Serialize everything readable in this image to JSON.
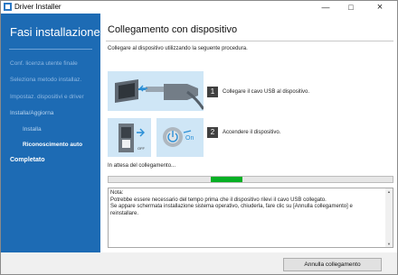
{
  "window": {
    "title": "Driver Installer"
  },
  "sidebar": {
    "title": "Fasi installazione",
    "steps": [
      {
        "label": "Conf. licenza utente finale"
      },
      {
        "label": "Seleziona metodo installaz."
      },
      {
        "label": "Impostaz. dispositivi e driver"
      },
      {
        "label": "Installa/Aggiorna"
      },
      {
        "label": "Installa"
      },
      {
        "label": "Riconoscimento auto"
      },
      {
        "label": "Completato"
      }
    ]
  },
  "main": {
    "title": "Collegamento con dispositivo",
    "intro": "Collegare al dispositivo utilizzando la seguente procedura.",
    "steps": [
      {
        "number": "1",
        "text": "Collegare il cavo USB al dispositivo."
      },
      {
        "number": "2",
        "text": "Accendere il dispositivo."
      }
    ],
    "illustration": {
      "on_label": "On",
      "off_label": "OFF"
    },
    "waiting": "In attesa del collegamento...",
    "progress": {
      "start": 0.36,
      "end": 0.47
    },
    "note_lines": [
      "Nota:",
      "Potrebbe essere necessario del tempo prima che il dispositivo rilevi il cavo USB collegato.",
      "Se appare schermata installazione sistema operativo, chiuderla, fare clic su [Annulla collegamento] e reinstallare."
    ]
  },
  "footer": {
    "cancel_label": "Annulla collegamento"
  },
  "colors": {
    "sidebar": "#1d6bb4",
    "progress": "#06b025"
  }
}
